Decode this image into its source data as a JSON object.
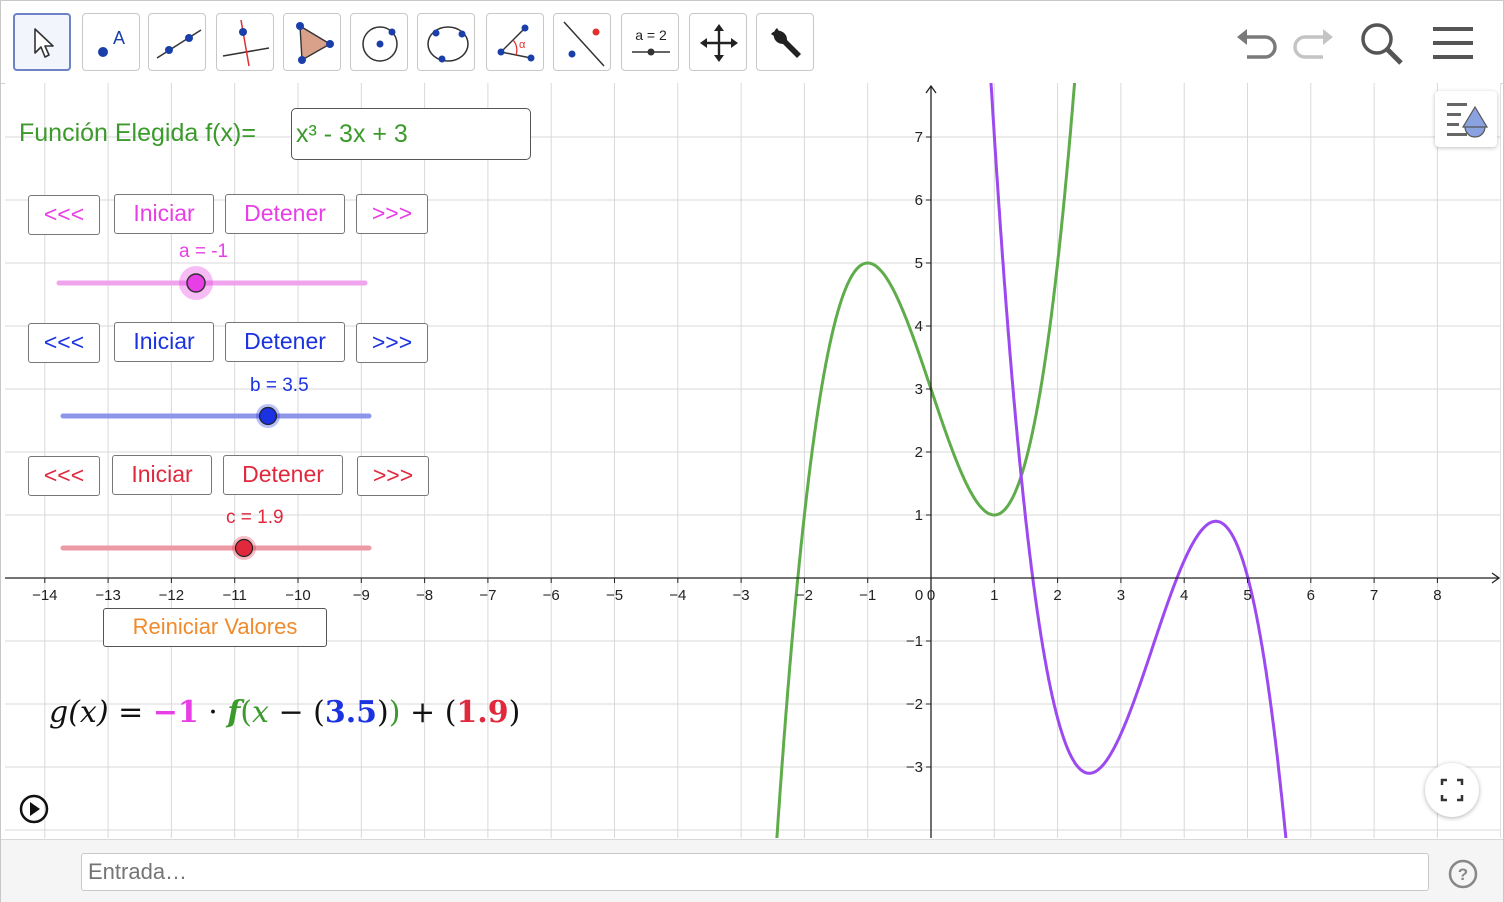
{
  "toolbar": {
    "tools": [
      {
        "name": "move-tool",
        "icon": "arrow-pointer-icon"
      },
      {
        "name": "point-tool",
        "icon": "point-a-icon",
        "label": "A"
      },
      {
        "name": "line-tool",
        "icon": "line-through-points-icon"
      },
      {
        "name": "perpendicular-line-tool",
        "icon": "perpendicular-line-icon"
      },
      {
        "name": "polygon-tool",
        "icon": "polygon-icon"
      },
      {
        "name": "circle-center-point-tool",
        "icon": "circle-center-point-icon"
      },
      {
        "name": "circle-three-points-tool",
        "icon": "circle-three-points-icon"
      },
      {
        "name": "angle-tool",
        "icon": "angle-icon",
        "label": "α"
      },
      {
        "name": "reflect-tool",
        "icon": "reflect-about-line-icon"
      },
      {
        "name": "slider-tool",
        "icon": "slider-icon",
        "label": "a = 2"
      },
      {
        "name": "move-graphics-view-tool",
        "icon": "move-arrows-icon"
      },
      {
        "name": "settings-tool",
        "icon": "wrench-icon"
      }
    ],
    "right": [
      "undo-icon",
      "redo-icon",
      "search-icon",
      "menu-icon"
    ]
  },
  "function_input": {
    "label": "Función Elegida f(x)=",
    "value": "x³ - 3x + 3"
  },
  "slider_groups": [
    {
      "color": "#e83ee6",
      "back_label": "<<<",
      "start_label": "Iniciar",
      "stop_label": "Detener",
      "forward_label": ">>>",
      "slider_label": "a = -1",
      "value": -1
    },
    {
      "color": "#1a32e0",
      "back_label": "<<<",
      "start_label": "Iniciar",
      "stop_label": "Detener",
      "forward_label": ">>>",
      "slider_label": "b = 3.5",
      "value": 3.5
    },
    {
      "color": "#e0293d",
      "back_label": "<<<",
      "start_label": "Iniciar",
      "stop_label": "Detener",
      "forward_label": ">>>",
      "slider_label": "c = 1.9",
      "value": 1.9
    }
  ],
  "reset_button": {
    "label": "Reiniciar Valores",
    "color": "#f08a2a"
  },
  "formula": {
    "part1": "g(x) = ",
    "a": "−1",
    "part2": " · ",
    "f": "f",
    "part3": "(",
    "x": "x",
    "part4": " − (",
    "b": "3.5",
    "part5": ")",
    "part6": ")",
    "part7": " + (",
    "c": "1.9",
    "part8": ")"
  },
  "input_bar": {
    "placeholder": "Entrada…"
  },
  "colors": {
    "f_curve": "#5fac4b",
    "g_curve": "#9c4af0",
    "grid": "#d9d9d9",
    "axis": "#222222",
    "text_green": "#3c9a2c"
  },
  "chart_data": {
    "type": "line",
    "x_range": [
      -14.5,
      9
    ],
    "y_range": [
      -4,
      7.75
    ],
    "x_ticks": [
      -14,
      -13,
      -12,
      -11,
      -10,
      -9,
      -8,
      -7,
      -6,
      -5,
      -4,
      -3,
      -2,
      -1,
      0,
      1,
      2,
      3,
      4,
      5,
      6,
      7,
      8
    ],
    "y_ticks": [
      -3,
      -2,
      -1,
      1,
      2,
      3,
      4,
      5,
      6,
      7
    ],
    "origin_label": "0",
    "grid": true,
    "series": [
      {
        "expression": "x^3 - 3x + 3",
        "color": "#5fac4b",
        "x": [
          -2.5,
          -2,
          -1.5,
          -1,
          -0.5,
          0,
          0.5,
          1,
          1.5,
          2,
          2.2
        ],
        "y": [
          -5.125,
          1,
          4.125,
          5,
          4.375,
          3,
          1.625,
          1,
          2.875,
          5,
          7.05
        ]
      },
      {
        "expression": "-1·f(x-3.5)+1.9",
        "color": "#9c4af0",
        "x": [
          0.9,
          1.5,
          2,
          2.5,
          3,
          3.5,
          4,
          4.5,
          5,
          5.5,
          5.6
        ],
        "y": [
          8.3,
          3.9,
          0.275,
          -3.1,
          -2.475,
          -1.1,
          0.275,
          0.9,
          0.275,
          -3.1,
          -4.0
        ]
      }
    ]
  }
}
